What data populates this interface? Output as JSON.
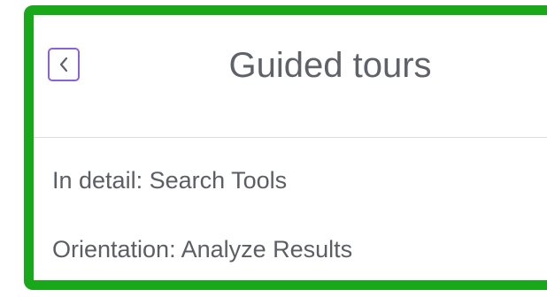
{
  "header": {
    "title": "Guided tours",
    "back_icon": "chevron-left-icon"
  },
  "tours": [
    {
      "label": "In detail: Search Tools"
    },
    {
      "label": "Orientation: Analyze Results"
    }
  ],
  "colors": {
    "outline": "#19a81a",
    "back_button_border": "#8a62d6",
    "text": "#5f6268",
    "divider": "#dcdcdc"
  }
}
